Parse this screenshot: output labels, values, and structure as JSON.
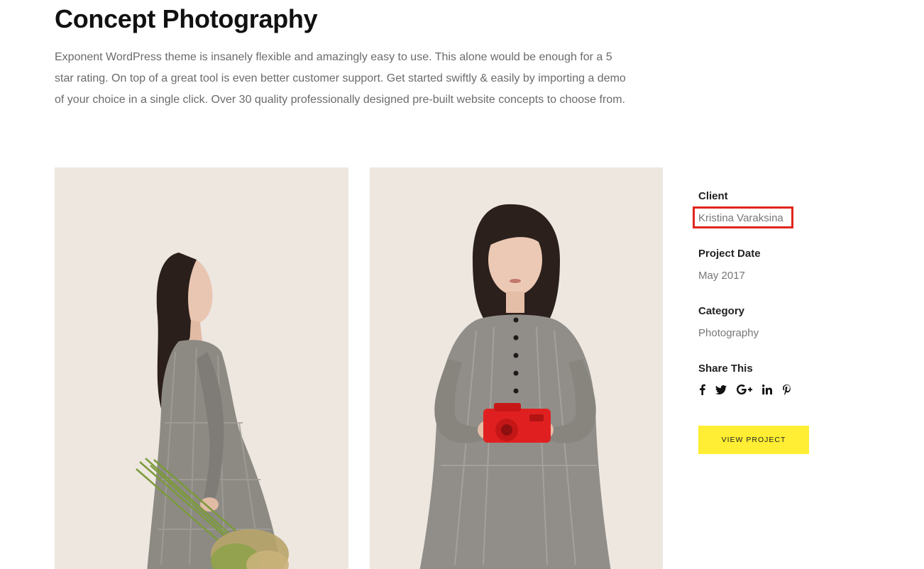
{
  "header": {
    "title": "Concept Photography"
  },
  "description": "Exponent WordPress theme is insanely flexible and amazingly easy to use. This alone would be enough for a 5 star rating. On top of a great tool is even better customer support. Get started swiftly & easily by importing a demo of your choice in a single click.  Over 30 quality professionally designed pre-built website concepts to choose from.",
  "sidebar": {
    "client_label": "Client",
    "client_value": "Kristina Varaksina",
    "date_label": "Project Date",
    "date_value": "May 2017",
    "category_label": "Category",
    "category_value": "Photography",
    "share_label": "Share This",
    "share_icons": [
      "facebook-icon",
      "twitter-icon",
      "google-plus-icon",
      "linkedin-icon",
      "pinterest-icon"
    ],
    "view_project_label": "VIEW PROJECT"
  },
  "colors": {
    "background": "#ffffff",
    "photo_background": "#ede7e0",
    "button_accent": "#ffee33",
    "highlight_outline": "#e0261c"
  }
}
